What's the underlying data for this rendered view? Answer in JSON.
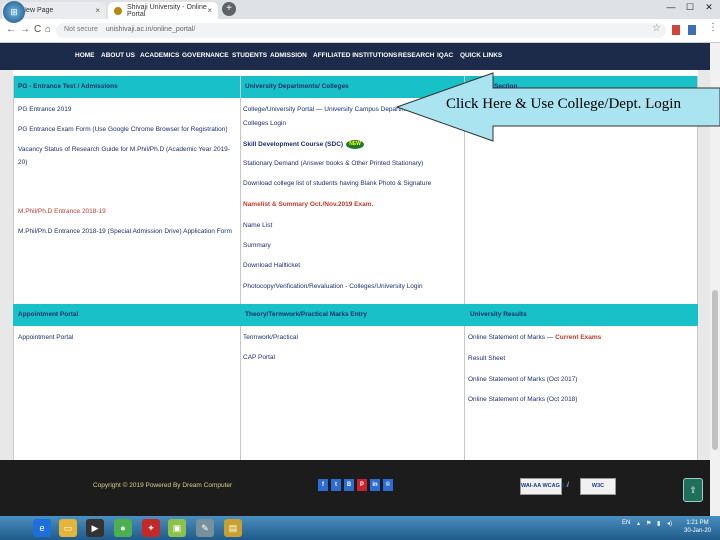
{
  "browser": {
    "tabs": [
      {
        "label": "New Page"
      },
      {
        "label": "Shivaji University - Online Portal"
      }
    ],
    "new_tab": "+",
    "window_controls": [
      "—",
      "☐",
      "✕"
    ],
    "nav": {
      "back": "←",
      "forward": "→",
      "reload": "C",
      "home": "⌂"
    },
    "address": {
      "security": "Not secure",
      "url": "unishivaji.ac.in/online_portal/"
    },
    "bookmark_star": "☆",
    "menu": "⋮"
  },
  "site_nav": {
    "items": [
      "HOME",
      "ABOUT US",
      "ACADEMICS",
      "GOVERNANCE",
      "STUDENTS",
      "ADMISSION",
      "AFFILIATED INSTITUTIONS",
      "RESEARCH",
      "IQAC",
      "QUICK LINKS"
    ]
  },
  "portal": {
    "top": {
      "col1_heading_a": "PG - Entrance Test / ",
      "col1_heading_b": "Admissions",
      "col1_links": [
        "PG Entrance 2019",
        "PG Entrance Exam Form (Use Google Chrome Browser for Registration)",
        "Vacancy Status of Research Guide for M.Phil/Ph.D (Academic Year 2019-",
        "20)",
        "M.Phil/Ph.D Entrance 2018-19",
        "M.Phil/Ph.D Entrance 2018-19 (Special Admission Drive) Application Form"
      ],
      "col2_heading": "University Departments/ Colleges",
      "col2_links": [
        "College/University Portal — University Campus Department",
        "Colleges Login",
        "Skill Development Course (SDC)",
        "Stationary Demand (Answer books & Other Printed Stationary)",
        "Download college list of students having Blank Photo & Signature",
        "Namelist & Summary Oct./Nov.2019 Exam.",
        "Name List",
        "Summary",
        "Download Hallticket",
        "Photocopy/Verification/Revaluation - Colleges/University Login"
      ],
      "col3_heading": "Section",
      "new_badge": "NEW"
    },
    "bottom": {
      "col1_heading": "Appointment Portal",
      "col1_links": [
        "Appointment Portal"
      ],
      "col2_heading": "Theory/Termwork/Practical Marks Entry",
      "col2_links": [
        "Termwork/Practical",
        "CAP Portal"
      ],
      "col3_heading": "University Results",
      "col3_links": [
        {
          "text": "Online Statement of Marks — ",
          "highlight": "Current Exams"
        },
        {
          "text": "Result Sheet",
          "highlight": ""
        },
        {
          "text": "Online Statement of Marks (Oct 2017)",
          "highlight": ""
        },
        {
          "text": "Online Statement of Marks (Oct 2018)",
          "highlight": ""
        }
      ]
    }
  },
  "footer": {
    "copyright": "Copyright © 2019 Powered By Dream Computer",
    "social": [
      "f",
      "t",
      "B",
      "P",
      "in",
      "©"
    ],
    "badges": [
      "WAI-AA WCAG 2.0",
      "W3C"
    ],
    "slash": "/",
    "to_top": "⇧"
  },
  "callout": {
    "text": "Click Here & Use College/Dept. Login"
  },
  "taskbar": {
    "start": "⊞",
    "tray_text": "EN",
    "time": "1:21 PM",
    "date": "30-Jan-20"
  },
  "colors": {
    "nav_bg": "#1c2b4a",
    "header_teal": "#18c0c7",
    "link_blue": "#1a2f6e",
    "highlight_red": "#c0392b",
    "callout_fill": "#a9e4f0"
  }
}
